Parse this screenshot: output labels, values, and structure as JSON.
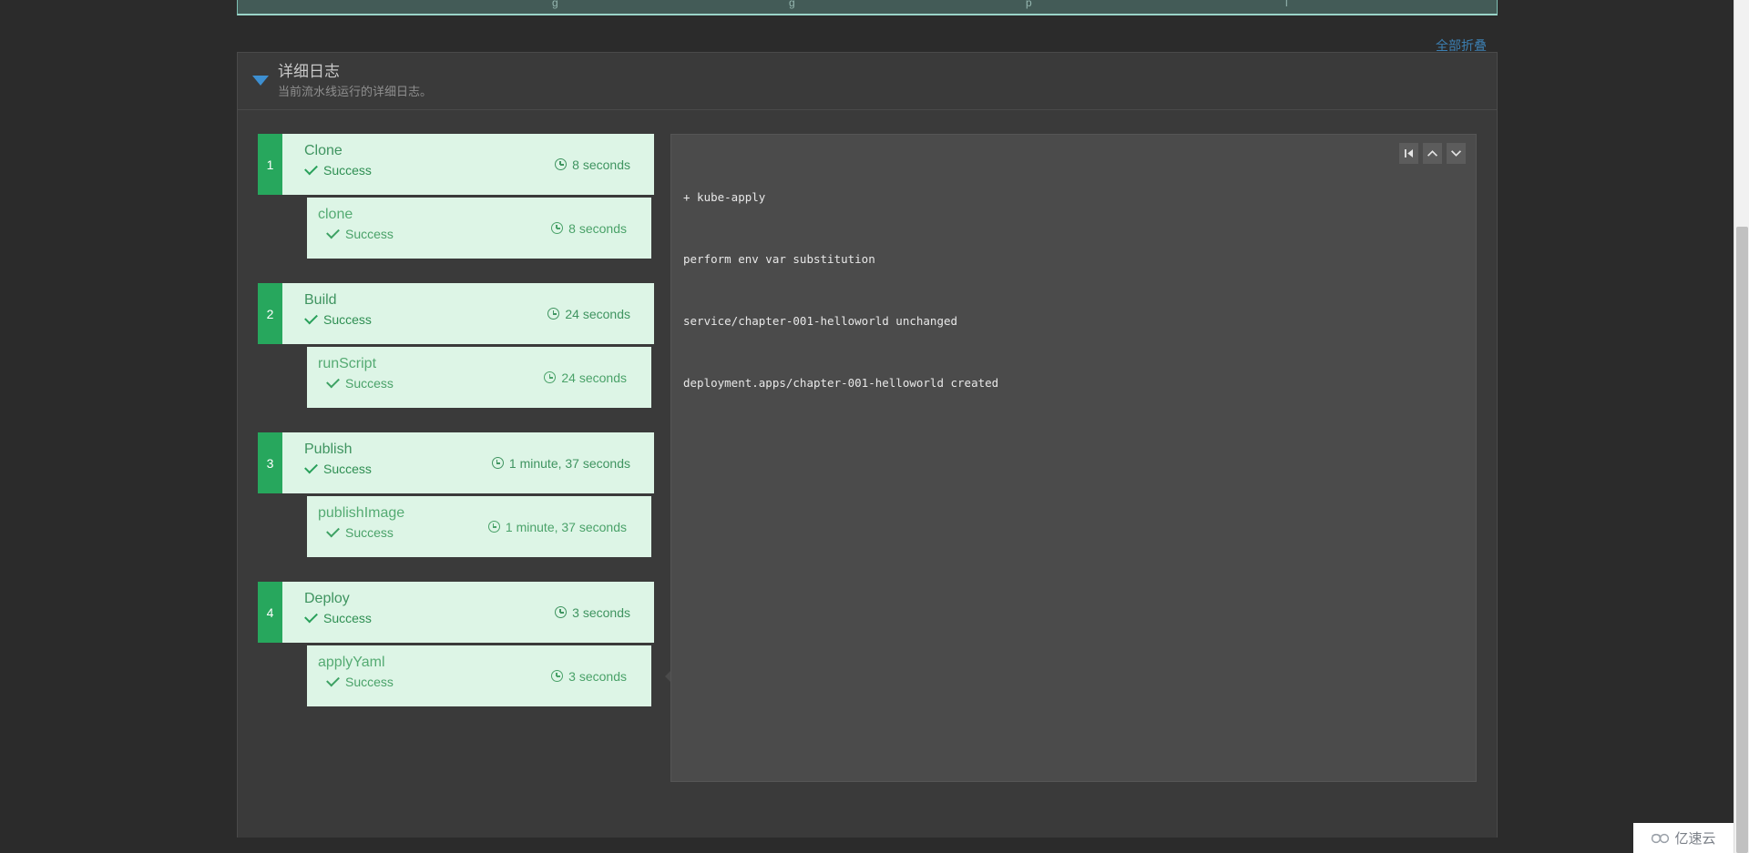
{
  "top_strip": {
    "ghost_labels": [
      "g",
      "g",
      "p",
      "l"
    ]
  },
  "toolbar": {
    "collapse_all_label": "全部折叠"
  },
  "panel": {
    "title": "详细日志",
    "subtitle": "当前流水线运行的详细日志。",
    "toggle_icon": "caret-down-icon"
  },
  "stages": [
    {
      "number": "1",
      "name": "Clone",
      "status": "Success",
      "duration": "8 seconds",
      "step": {
        "name": "clone",
        "status": "Success",
        "duration": "8 seconds",
        "selected": false
      }
    },
    {
      "number": "2",
      "name": "Build",
      "status": "Success",
      "duration": "24 seconds",
      "step": {
        "name": "runScript",
        "status": "Success",
        "duration": "24 seconds",
        "selected": false
      }
    },
    {
      "number": "3",
      "name": "Publish",
      "status": "Success",
      "duration": "1 minute, 37 seconds",
      "step": {
        "name": "publishImage",
        "status": "Success",
        "duration": "1 minute, 37 seconds",
        "selected": false
      }
    },
    {
      "number": "4",
      "name": "Deploy",
      "status": "Success",
      "duration": "3 seconds",
      "step": {
        "name": "applyYaml",
        "status": "Success",
        "duration": "3 seconds",
        "selected": true
      }
    }
  ],
  "log": {
    "controls": [
      {
        "name": "jump-to-top-icon",
        "title": "K"
      },
      {
        "name": "scroll-up-icon",
        "title": "^"
      },
      {
        "name": "scroll-down-icon",
        "title": "v"
      }
    ],
    "lines": [
      "+ kube-apply",
      "perform env var substitution",
      "service/chapter-001-helloworld unchanged",
      "deployment.apps/chapter-001-helloworld created"
    ]
  },
  "watermark": {
    "text": "亿速云",
    "icon": "cloud-logo-icon"
  },
  "colors": {
    "badge_green": "#27a75d",
    "card_bg": "#ddf5e6",
    "stage_text": "#3f9460",
    "step_text": "#55ab73",
    "link_blue": "#3c7fb1",
    "panel_bg": "#3a3a3a",
    "log_bg": "#4b4b4b",
    "page_bg": "#2b2b2b",
    "teal_strip": "#435b57"
  }
}
